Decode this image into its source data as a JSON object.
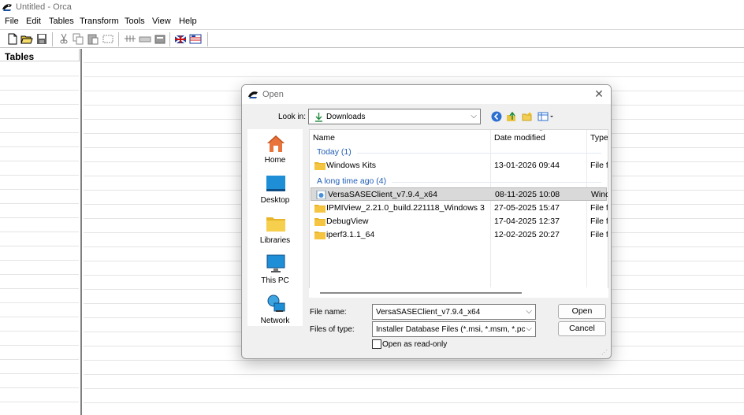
{
  "window": {
    "title": "Untitled - Orca"
  },
  "menu": {
    "items": [
      "File",
      "Edit",
      "Tables",
      "Transform",
      "Tools",
      "View",
      "Help"
    ]
  },
  "toolbar": {
    "buttons": [
      "new-icon",
      "open-icon",
      "save-icon",
      "cut-icon",
      "copy-icon",
      "paste-icon",
      "add-row-icon",
      "validate-icon",
      "merge-icon",
      "transform-icon",
      "summary-icon",
      "flag-uk-icon",
      "flag-table-icon"
    ]
  },
  "tables_pane": {
    "header": "Tables"
  },
  "dialog": {
    "title": "Open",
    "look_in_label": "Look in:",
    "look_in_value": "Downloads",
    "places": [
      "Home",
      "Desktop",
      "Libraries",
      "This PC",
      "Network"
    ],
    "columns": [
      "Name",
      "Date modified",
      "Type"
    ],
    "groups": [
      {
        "label": "Today (1)"
      },
      {
        "label": "A long time ago (4)"
      }
    ],
    "files": [
      {
        "name": "Windows Kits",
        "date": "13-01-2026 09:44",
        "type": "File fo",
        "icon": "folder-icon",
        "selected": false
      },
      {
        "name": "VersaSASEClient_v7.9.4_x64",
        "date": "08-11-2025 10:08",
        "type": "Wind",
        "icon": "installer-icon",
        "selected": true
      },
      {
        "name": "IPMIView_2.21.0_build.221118_Windows 3",
        "date": "27-05-2025 15:47",
        "type": "File fo",
        "icon": "folder-icon",
        "selected": false
      },
      {
        "name": "DebugView",
        "date": "17-04-2025 12:37",
        "type": "File fo",
        "icon": "folder-icon",
        "selected": false
      },
      {
        "name": "iperf3.1.1_64",
        "date": "12-02-2025 20:27",
        "type": "File fo",
        "icon": "folder-icon",
        "selected": false
      }
    ],
    "file_name_label": "File name:",
    "file_name_value": "VersaSASEClient_v7.9.4_x64",
    "file_type_label": "Files of type:",
    "file_type_value": "Installer Database Files (*.msi, *.msm, *.pcp, *.m",
    "open_button": "Open",
    "cancel_button": "Cancel",
    "readonly_label": "Open as read-only",
    "readonly_checked": false
  },
  "colors": {
    "group_text": "#1f5cb6",
    "selection": "#d9d9d9",
    "folder": "#f5c542"
  }
}
